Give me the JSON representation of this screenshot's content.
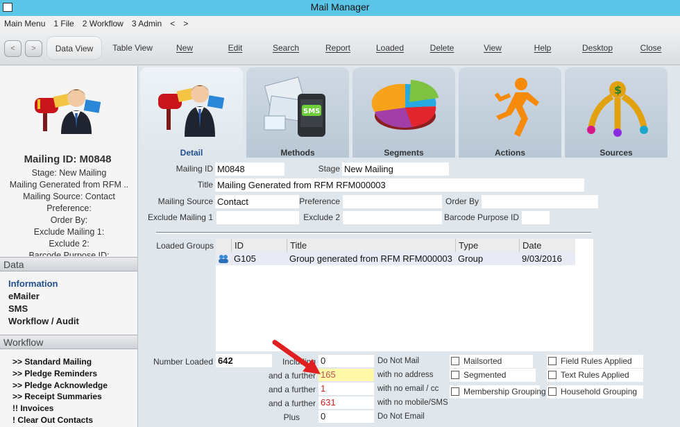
{
  "window": {
    "title": "Mail Manager"
  },
  "menu": [
    "Main Menu",
    "1 File",
    "2 Workflow",
    "3 Admin",
    "<",
    ">"
  ],
  "toolbar": {
    "back": "<",
    "forward": ">",
    "buttons": [
      "Data View",
      "Table View",
      "New",
      "Edit",
      "Search",
      "Report",
      "Loaded",
      "Delete",
      "View",
      "Help",
      "Desktop",
      "Close"
    ]
  },
  "left": {
    "mailing_id": "Mailing ID: M0848",
    "summary": [
      "Stage: New Mailing",
      "Mailing Generated from RFM ..",
      "Mailing Source: Contact",
      "Preference:",
      "Order By:",
      "Exclude Mailing 1:",
      "Exclude 2:",
      "Barcode Purpose ID:"
    ],
    "data_header": "Data",
    "data_links": [
      "Information",
      "eMailer",
      "SMS",
      "Workflow / Audit"
    ],
    "workflow_header": "Workflow",
    "workflow_links": [
      ">> Standard Mailing",
      ">> Pledge Reminders",
      ">> Pledge Acknowledge",
      ">> Receipt Summaries",
      "!! Invoices",
      "! Clear Out Contacts"
    ]
  },
  "tabs": [
    "Detail",
    "Methods",
    "Segments",
    "Actions",
    "Sources"
  ],
  "tab_icons": [
    "mailbox-person-icon",
    "sms-envelopes-icon",
    "pie-chart-icon",
    "running-man-icon",
    "dollar-sources-icon"
  ],
  "detail": {
    "mailing_id_label": "Mailing ID",
    "mailing_id": "M0848",
    "stage_label": "Stage",
    "stage": "New Mailing",
    "title_label": "Title",
    "title": "Mailing Generated from RFM RFM000003",
    "source_label": "Mailing Source",
    "source": "Contact",
    "preference_label": "Preference",
    "preference": "",
    "order_label": "Order By",
    "order": "",
    "exclude1_label": "Exclude Mailing 1",
    "exclude1": "",
    "exclude2_label": "Exclude 2",
    "exclude2": "",
    "barcode_label": "Barcode Purpose ID",
    "barcode": ""
  },
  "groups": {
    "label": "Loaded Groups",
    "columns": [
      "ID",
      "Title",
      "Type",
      "Date"
    ],
    "rows": [
      {
        "id": "G105",
        "title": "Group generated from RFM RFM000003",
        "type": "Group",
        "date": "9/03/2016"
      }
    ]
  },
  "counts": {
    "number_loaded_label": "Number Loaded",
    "number_loaded": "642",
    "lines": [
      {
        "label": "Including",
        "value": "0",
        "desc": "Do Not Mail"
      },
      {
        "label": "and a further",
        "value": "165",
        "desc": "with no address"
      },
      {
        "label": "and a further",
        "value": "1",
        "desc": "with no email / cc"
      },
      {
        "label": "and a further",
        "value": "631",
        "desc": "with no mobile/SMS"
      },
      {
        "label": "Plus",
        "value": "0",
        "desc": "Do Not Email"
      }
    ]
  },
  "checks": {
    "mailsorted": "Mailsorted",
    "segmented": "Segmented",
    "membership": "Membership Grouping",
    "field_rules": "Field Rules Applied",
    "text_rules": "Text Rules Applied",
    "household": "Household Grouping"
  },
  "colors": {
    "titlebar": "#5bc5e8",
    "accent": "#1f4e8c",
    "arrow": "#e02020",
    "highlight": "#fff8a8"
  }
}
